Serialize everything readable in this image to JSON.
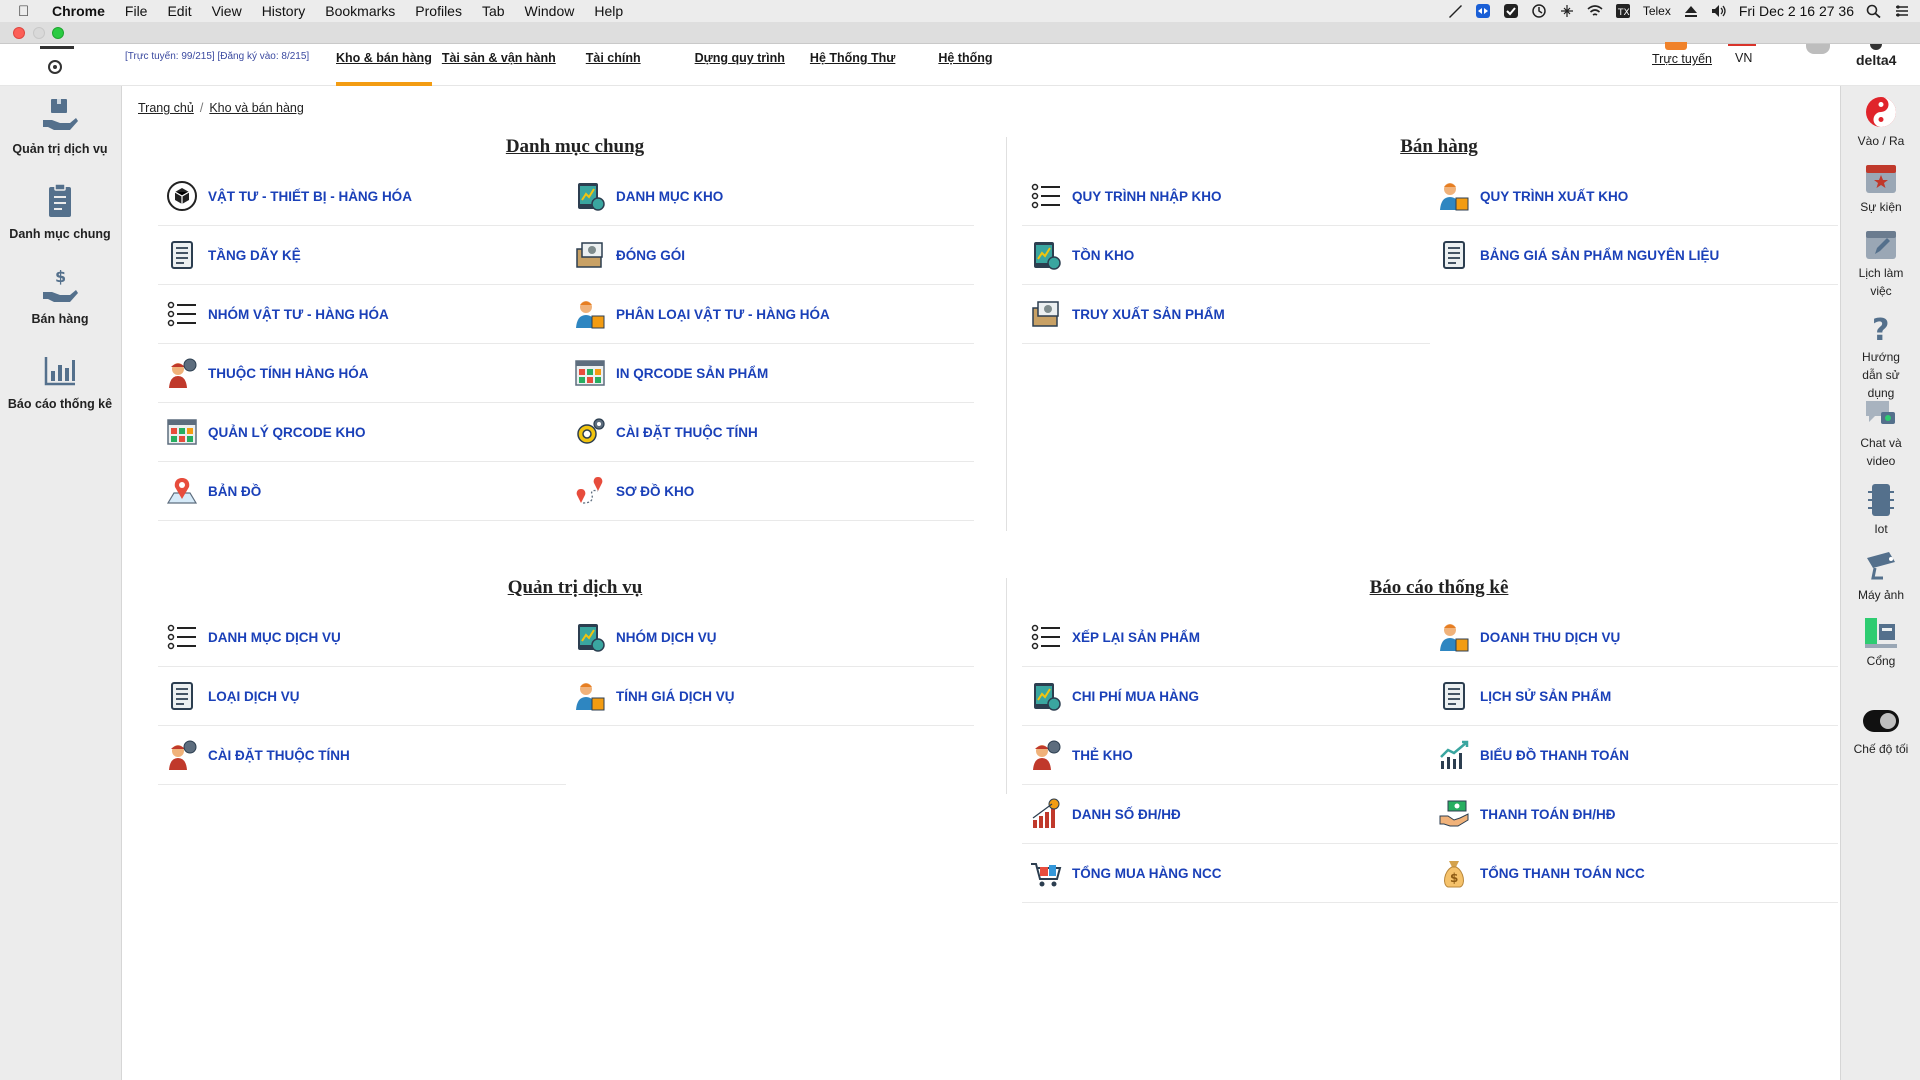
{
  "os_menubar": {
    "app_name": "Chrome",
    "menus": [
      "File",
      "Edit",
      "View",
      "History",
      "Bookmarks",
      "Profiles",
      "Tab",
      "Window",
      "Help"
    ],
    "input_method": "Telex",
    "datetime": "Fri Dec 2  16 27 36"
  },
  "header": {
    "online_stats": "[Trực tuyến: 99/215] [Đăng ký vào: 8/215]",
    "tabs": [
      {
        "label": "Kho & bán hàng",
        "active": true
      },
      {
        "label": "Tài sản & vận hành",
        "active": false
      },
      {
        "label": "Tài chính",
        "active": false
      },
      {
        "label": "Dựng quy trình",
        "active": false
      },
      {
        "label": "Hệ Thống Thư",
        "active": false
      },
      {
        "label": "Hệ thống",
        "active": false
      }
    ],
    "online_link": "Trực tuyến",
    "language": "VN",
    "username": "delta4"
  },
  "left_sidebar": {
    "items": [
      {
        "label": "Quản trị dịch vụ",
        "icon": "service-admin-icon"
      },
      {
        "label": "Danh mục chung",
        "icon": "clipboard-icon"
      },
      {
        "label": "Bán hàng",
        "icon": "hand-dollar-icon"
      },
      {
        "label": "Báo cáo thống kê",
        "icon": "bar-chart-icon"
      }
    ]
  },
  "right_sidebar": {
    "items": [
      {
        "label": "Vào / Ra",
        "icon": "yin-yang-icon"
      },
      {
        "label": "Sự kiện",
        "icon": "calendar-event-icon"
      },
      {
        "label": "Lịch làm việc",
        "icon": "calendar-edit-icon"
      },
      {
        "label": "Hướng dẫn sử dụng",
        "icon": "help-icon"
      },
      {
        "label": "Chat và video",
        "icon": "chat-video-icon"
      },
      {
        "label": "Iot",
        "icon": "iot-device-icon"
      },
      {
        "label": "Máy ảnh",
        "icon": "camera-icon"
      },
      {
        "label": "Cổng",
        "icon": "gate-icon"
      },
      {
        "label": "Chế độ tối",
        "icon": "dark-mode-toggle-icon"
      }
    ]
  },
  "breadcrumb": {
    "home": "Trang chủ",
    "current": "Kho và bán hàng"
  },
  "sections": {
    "danh_muc_chung": {
      "title": "Danh mục chung",
      "items": [
        {
          "label": "VẬT TƯ - THIẾT BỊ - HÀNG HÓA",
          "icon": "box-icon"
        },
        {
          "label": "DANH MỤC KHO",
          "icon": "tablet-chart-icon"
        },
        {
          "label": "TẦNG DÃY KỆ",
          "icon": "document-list-icon"
        },
        {
          "label": "ĐÓNG GÓI",
          "icon": "package-gear-icon"
        },
        {
          "label": "NHÓM VẬT TƯ - HÀNG HÓA",
          "icon": "list-icon"
        },
        {
          "label": "PHÂN LOẠI VẬT TƯ - HÀNG HÓA",
          "icon": "worker-icon"
        },
        {
          "label": "THUỘC TÍNH HÀNG HÓA",
          "icon": "mechanic-icon"
        },
        {
          "label": "IN QRCODE SẢN PHẨM",
          "icon": "qr-board-icon"
        },
        {
          "label": "QUẢN LÝ QRCODE KHO",
          "icon": "qr-board-icon"
        },
        {
          "label": "CÀI ĐẶT THUỘC TÍNH",
          "icon": "gears-icon"
        },
        {
          "label": "BẢN ĐỒ",
          "icon": "map-pin-icon"
        },
        {
          "label": "SƠ ĐỒ KHO",
          "icon": "route-pins-icon"
        }
      ]
    },
    "ban_hang": {
      "title": "Bán hàng",
      "items": [
        {
          "label": "QUY TRÌNH NHẬP KHO",
          "icon": "list-icon"
        },
        {
          "label": "QUY TRÌNH XUẤT KHO",
          "icon": "worker-icon"
        },
        {
          "label": "TỒN KHO",
          "icon": "tablet-chart-icon"
        },
        {
          "label": "BẢNG GIÁ SẢN PHẨM NGUYÊN LIỆU",
          "icon": "document-list-icon"
        },
        {
          "label": "TRUY XUẤT SẢN PHẨM",
          "icon": "package-gear-icon"
        }
      ]
    },
    "quan_tri_dich_vu": {
      "title": "Quản trị dịch vụ",
      "items": [
        {
          "label": "DANH MỤC DỊCH VỤ",
          "icon": "list-icon"
        },
        {
          "label": "NHÓM DỊCH VỤ",
          "icon": "tablet-chart-icon"
        },
        {
          "label": "LOẠI DỊCH VỤ",
          "icon": "document-list-icon"
        },
        {
          "label": "TÍNH GIÁ DỊCH VỤ",
          "icon": "worker-icon"
        },
        {
          "label": "CÀI ĐẶT THUỘC TÍNH",
          "icon": "mechanic-icon"
        }
      ]
    },
    "bao_cao_thong_ke": {
      "title": "Báo cáo thống kê",
      "items": [
        {
          "label": "XẾP LẠI SẢN PHẨM",
          "icon": "list-icon"
        },
        {
          "label": "DOANH THU DỊCH VỤ",
          "icon": "worker-icon"
        },
        {
          "label": "CHI PHÍ MUA HÀNG",
          "icon": "tablet-chart-icon"
        },
        {
          "label": "LỊCH SỬ SẢN PHẨM",
          "icon": "document-list-icon"
        },
        {
          "label": "THẺ KHO",
          "icon": "mechanic-icon"
        },
        {
          "label": "BIỂU ĐỒ THANH TOÁN",
          "icon": "line-chart-icon"
        },
        {
          "label": "DANH SỐ ĐH/HĐ",
          "icon": "growth-bars-icon"
        },
        {
          "label": "THANH TOÁN ĐH/HĐ",
          "icon": "handshake-money-icon"
        },
        {
          "label": "TỔNG MUA HÀNG NCC",
          "icon": "cart-icon"
        },
        {
          "label": "TỔNG THANH TOÁN NCC",
          "icon": "money-bag-icon"
        }
      ]
    }
  },
  "colors": {
    "accent": "#f39c12",
    "link": "#1a40b8",
    "sidebar_bg": "#ececec"
  }
}
